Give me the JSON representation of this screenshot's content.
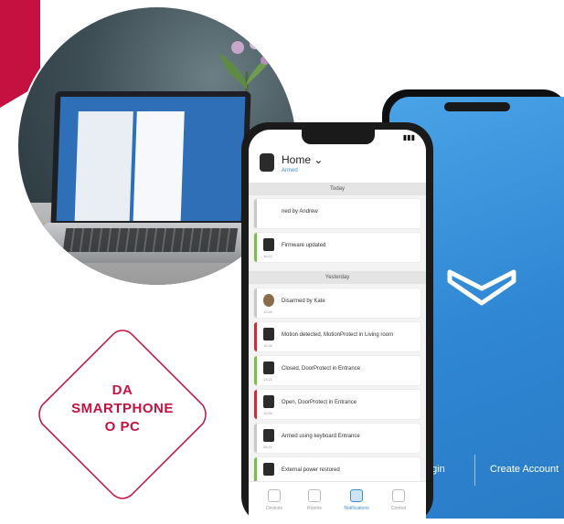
{
  "badge": {
    "lines": [
      "DA",
      "SMARTPHONE",
      "O PC"
    ],
    "color": "#c4113f"
  },
  "blue_phone": {
    "login_label": "ogin",
    "create_account_label": "Create Account",
    "logo_icon": "ajax-logo-icon"
  },
  "app": {
    "header": {
      "title": "Home",
      "subtitle": "Armed"
    },
    "sections": {
      "today": "Today",
      "yesterday": "Yesterday"
    },
    "today_events": [
      {
        "label": "ned by Andrew"
      },
      {
        "label": "Firmware updated",
        "time": "16:12"
      }
    ],
    "yesterday_events": [
      {
        "label": "Disarmed by Kate",
        "time": "12:40",
        "bar": "#c9c9c9"
      },
      {
        "label": "Motion detected, MotionProtect in Living room",
        "time": "16:40",
        "bar": "#d6283a"
      },
      {
        "label": "Closed, DoorProtect in Entrance",
        "time": "13:21",
        "bar": "#7ac043"
      },
      {
        "label": "Open, DoorProtect in Entrance",
        "time": "10:00",
        "bar": "#d6283a"
      },
      {
        "label": "Armed using keyboard Entrance",
        "time": "08:21",
        "bar": "#c9c9c9"
      },
      {
        "label": "External power restored",
        "time": "",
        "bar": "#7ac043"
      }
    ],
    "tabs": [
      {
        "label": "Devices",
        "icon": "devices-icon"
      },
      {
        "label": "Rooms",
        "icon": "rooms-icon"
      },
      {
        "label": "Notifications",
        "icon": "notifications-icon",
        "active": true
      },
      {
        "label": "Control",
        "icon": "control-icon"
      }
    ]
  }
}
